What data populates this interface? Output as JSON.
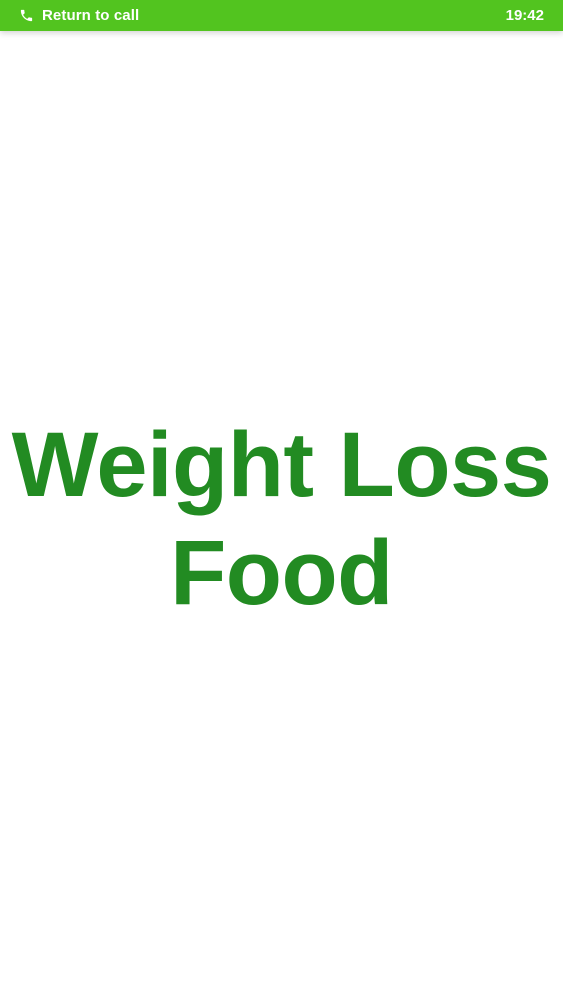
{
  "status_bar": {
    "background": "#52c41f",
    "call_banner_label": "Return to call",
    "call_icon": "phone-icon",
    "time": "19:42"
  },
  "splash": {
    "title_line1": "Weight Loss",
    "title_line2": "Food",
    "title_color": "#228b22",
    "background": "#ffffff"
  }
}
